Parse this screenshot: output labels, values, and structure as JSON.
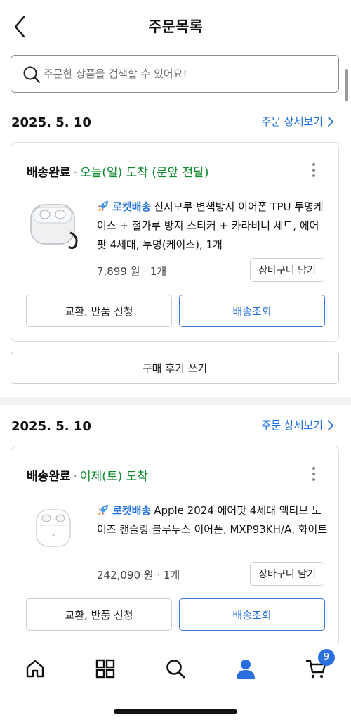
{
  "header": {
    "title": "주문목록"
  },
  "search": {
    "placeholder": "주문한 상품을 검색할 수 있어요!"
  },
  "orders": [
    {
      "date": "2025. 5. 10",
      "detail_label": "주문 상세보기",
      "status_main": "배송완료",
      "status_sub": "오늘(일) 도착 (문앞 전달)",
      "delivery_tag": "로켓배송",
      "product_name": "신지모루 변색방지 이어폰 TPU 투명케이스 + 철가루 방지 스티커 + 카라비너 세트, 에어팟 4세대, 투명(케이스), 1개",
      "price": "7,899 원",
      "quantity": "1개",
      "cart_label": "장바구니 담기",
      "exchange_label": "교환, 반품 신청",
      "track_label": "배송조회",
      "review_label": "구매 후기 쓰기"
    },
    {
      "date": "2025. 5. 10",
      "detail_label": "주문 상세보기",
      "status_main": "배송완료",
      "status_sub": "어제(토) 도착",
      "delivery_tag": "로켓배송",
      "product_name": "Apple 2024 에어팟 4세대 액티브 노이즈 캔슬링 블루투스 이어폰, MXP93KH/A, 화이트",
      "price": "242,090 원",
      "quantity": "1개",
      "cart_label": "장바구니 담기",
      "exchange_label": "교환, 반품 신청",
      "track_label": "배송조회"
    }
  ],
  "bottom_nav": {
    "cart_badge": "9",
    "active_item": "my-page"
  },
  "colors": {
    "accent_blue": "#1f6fe0",
    "status_green": "#0f8a2e"
  }
}
